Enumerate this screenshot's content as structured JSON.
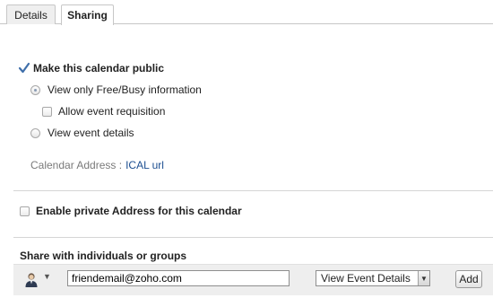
{
  "tabs": [
    {
      "label": "Details"
    },
    {
      "label": "Sharing"
    }
  ],
  "public_section": {
    "make_public_label": "Make this calendar public",
    "option_freebusy_label": "View only Free/Busy information",
    "allow_requisition_label": "Allow event requisition",
    "option_event_details_label": "View event details",
    "address_label": "Calendar Address :",
    "address_link": "ICAL url"
  },
  "private_section": {
    "enable_private_label": "Enable private Address for this calendar"
  },
  "share_section": {
    "title": "Share with individuals or groups",
    "email_value": "friendemail@zoho.com",
    "permission_selected": "View Event Details",
    "add_label": "Add"
  },
  "colors": {
    "accent_link": "#1d4f91",
    "share_bar_bg": "#eeeeee"
  },
  "icons": {
    "checkmark": "checkmark-icon",
    "user": "user-icon",
    "dropdown": "chevron-down-icon"
  }
}
